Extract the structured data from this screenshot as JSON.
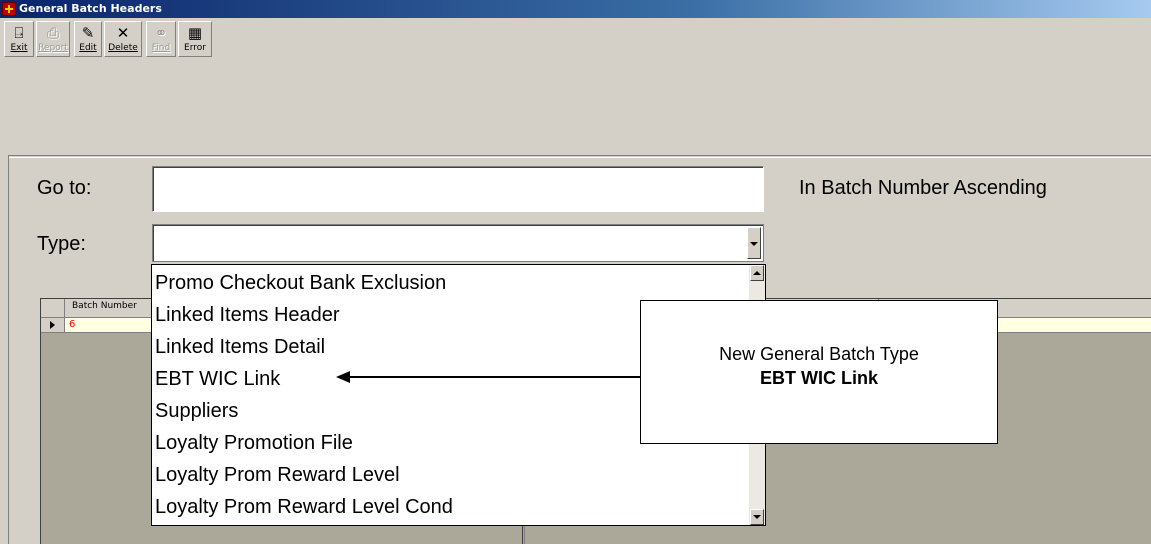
{
  "window": {
    "title": "General Batch Headers"
  },
  "toolbar": {
    "buttons": [
      {
        "label": "Exit",
        "icon": "exit-door-icon",
        "enabled": true
      },
      {
        "label": "Report",
        "icon": "printer-icon",
        "enabled": false
      },
      {
        "label": "Edit",
        "icon": "edit-icon",
        "enabled": true
      },
      {
        "label": "Delete",
        "icon": "delete-x-icon",
        "enabled": true
      },
      {
        "label": "Find",
        "icon": "binoculars-icon",
        "enabled": false
      },
      {
        "label": "Error",
        "icon": "grid-icon",
        "enabled": true
      }
    ]
  },
  "form": {
    "goto_label": "Go to:",
    "goto_value": "",
    "sort_text": "In Batch Number Ascending",
    "type_label": "Type:",
    "type_value": ""
  },
  "grid": {
    "columns": [
      "Batch Number"
    ],
    "rows": [
      {
        "batch_number": "6"
      }
    ],
    "current_row_color": "#ffffe1",
    "value_color": "#ff0000"
  },
  "type_dropdown": {
    "options": [
      "Promo Checkout Bank Exclusion",
      "Linked Items Header",
      "Linked Items Detail",
      "EBT WIC Link",
      "Suppliers",
      "Loyalty Promotion File",
      "Loyalty Prom Reward Level",
      "Loyalty Prom Reward Level Cond"
    ]
  },
  "callout": {
    "line1": "New General Batch Type",
    "line2": "EBT WIC Link"
  }
}
